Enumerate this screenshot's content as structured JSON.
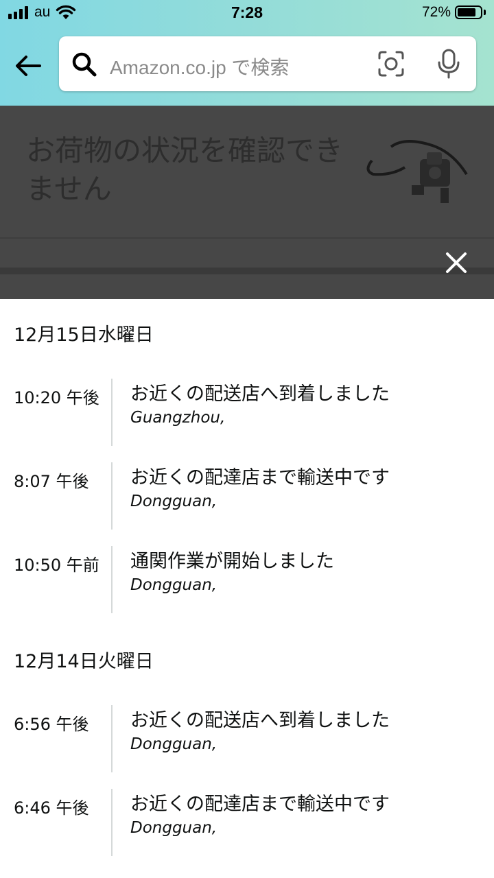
{
  "status_bar": {
    "carrier": "au",
    "time": "7:28",
    "battery": "72%",
    "battery_level": 0.72
  },
  "search": {
    "placeholder": "Amazon.co.jp で検索"
  },
  "background_page": {
    "title": "お荷物の状況を確認できません"
  },
  "tracking": {
    "groups": [
      {
        "date": "12月15日水曜日",
        "events": [
          {
            "time": "10:20 午後",
            "status": "お近くの配送店へ到着しました",
            "location": "Guangzhou,"
          },
          {
            "time": "8:07 午後",
            "status": "お近くの配達店まで輸送中です",
            "location": "Dongguan,"
          },
          {
            "time": "10:50 午前",
            "status": "通関作業が開始しました",
            "location": "Dongguan,"
          }
        ]
      },
      {
        "date": "12月14日火曜日",
        "events": [
          {
            "time": "6:56 午後",
            "status": "お近くの配送店へ到着しました",
            "location": "Dongguan,"
          },
          {
            "time": "6:46 午後",
            "status": "お近くの配達店まで輸送中です",
            "location": "Dongguan,"
          }
        ]
      }
    ]
  }
}
